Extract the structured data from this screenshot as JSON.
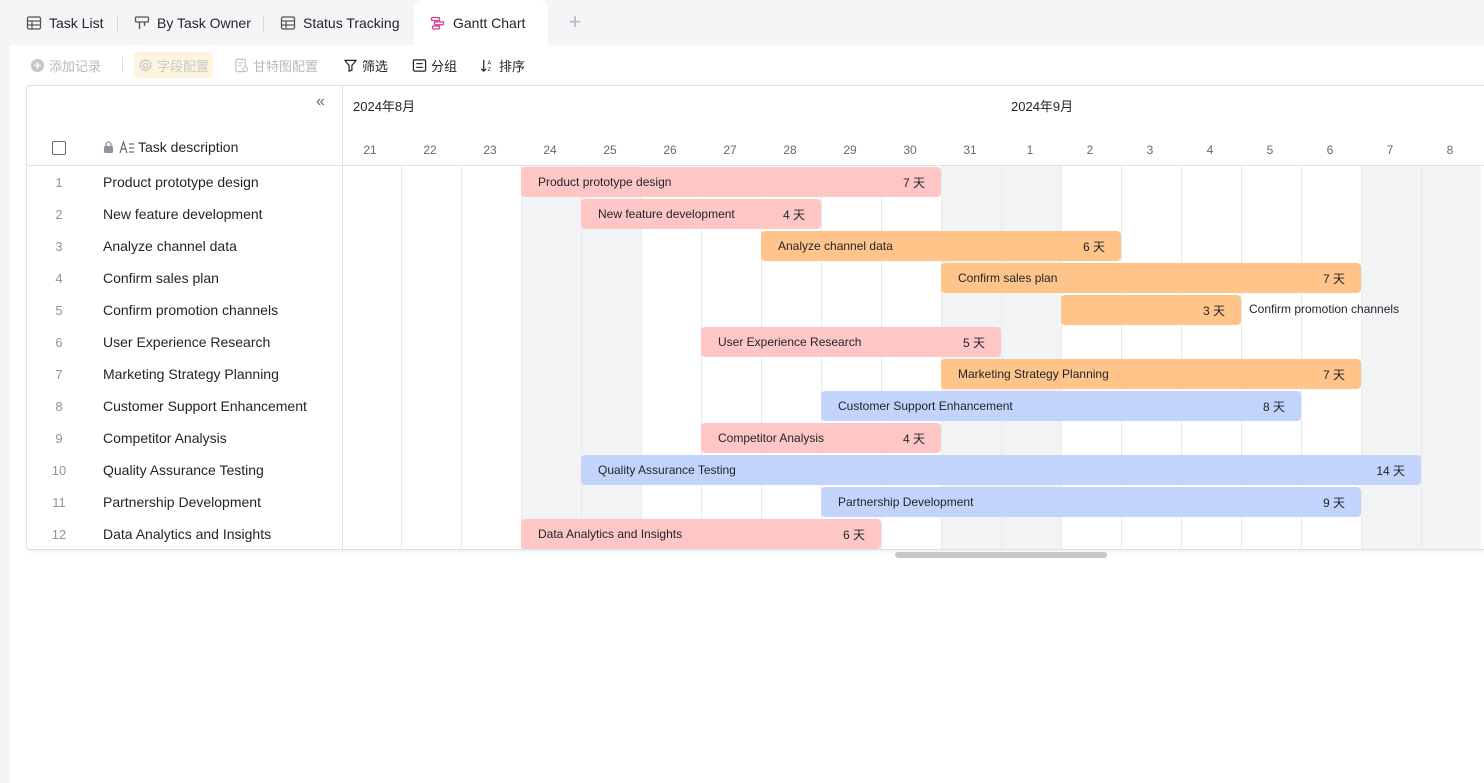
{
  "tabs": [
    {
      "label": "Task List",
      "icon": "grid-table-icon"
    },
    {
      "label": "By Task Owner",
      "icon": "kanban-icon"
    },
    {
      "label": "Status Tracking",
      "icon": "grid-table-icon"
    },
    {
      "label": "Gantt Chart",
      "icon": "gantt-icon",
      "active": true
    }
  ],
  "toolbar": {
    "add_record": "添加记录",
    "field_config": "字段配置",
    "gantt_config": "甘特图配置",
    "filter": "筛选",
    "group": "分组",
    "sort": "排序"
  },
  "grid": {
    "column_header": "Task description",
    "rows": [
      {
        "num": "1",
        "desc": "Product prototype design"
      },
      {
        "num": "2",
        "desc": "New feature development"
      },
      {
        "num": "3",
        "desc": "Analyze channel data"
      },
      {
        "num": "4",
        "desc": "Confirm sales plan"
      },
      {
        "num": "5",
        "desc": "Confirm promotion channels"
      },
      {
        "num": "6",
        "desc": "User Experience Research"
      },
      {
        "num": "7",
        "desc": "Marketing Strategy Planning"
      },
      {
        "num": "8",
        "desc": "Customer Support Enhancement"
      },
      {
        "num": "9",
        "desc": "Competitor Analysis"
      },
      {
        "num": "10",
        "desc": "Quality Assurance Testing"
      },
      {
        "num": "11",
        "desc": "Partnership Development"
      },
      {
        "num": "12",
        "desc": "Data Analytics and Insights"
      }
    ]
  },
  "timeline": {
    "months": [
      {
        "label": "2024年8月",
        "first_day_index": 0
      },
      {
        "label": "2024年9月",
        "first_day_index": 11
      }
    ],
    "days": [
      "21",
      "22",
      "23",
      "24",
      "25",
      "26",
      "27",
      "28",
      "29",
      "30",
      "31",
      "1",
      "2",
      "3",
      "4",
      "5",
      "6",
      "7",
      "8"
    ],
    "weekend_day_indexes": [
      3,
      4,
      10,
      11,
      17,
      18
    ],
    "colors": {
      "pink": "#ffc6c6",
      "orange": "#ffc48a",
      "blue": "#c2d4fc"
    },
    "bars": [
      {
        "row": 0,
        "start_day_index": 3,
        "days": 7,
        "label": "Product prototype design",
        "duration": "7 天",
        "color": "pink"
      },
      {
        "row": 1,
        "start_day_index": 4,
        "days": 4,
        "label": "New feature development",
        "duration": "4 天",
        "color": "pink"
      },
      {
        "row": 2,
        "start_day_index": 7,
        "days": 6,
        "label": "Analyze channel data",
        "duration": "6 天",
        "color": "orange"
      },
      {
        "row": 3,
        "start_day_index": 10,
        "days": 7,
        "label": "Confirm sales plan",
        "duration": "7 天",
        "color": "orange"
      },
      {
        "row": 4,
        "start_day_index": 12,
        "days": 3,
        "label": "Confirm promotion channels",
        "duration": "3 天",
        "color": "orange",
        "label_outside": true
      },
      {
        "row": 5,
        "start_day_index": 6,
        "days": 5,
        "label": "User Experience Research",
        "duration": "5 天",
        "color": "pink"
      },
      {
        "row": 6,
        "start_day_index": 10,
        "days": 7,
        "label": "Marketing Strategy Planning",
        "duration": "7 天",
        "color": "orange"
      },
      {
        "row": 7,
        "start_day_index": 8,
        "days": 8,
        "label": "Customer Support Enhancement",
        "duration": "8 天",
        "color": "blue"
      },
      {
        "row": 8,
        "start_day_index": 6,
        "days": 4,
        "label": "Competitor Analysis",
        "duration": "4 天",
        "color": "pink"
      },
      {
        "row": 9,
        "start_day_index": 4,
        "days": 14,
        "label": "Quality Assurance Testing",
        "duration": "14 天",
        "color": "blue"
      },
      {
        "row": 10,
        "start_day_index": 8,
        "days": 9,
        "label": "Partnership Development",
        "duration": "9 天",
        "color": "blue"
      },
      {
        "row": 11,
        "start_day_index": 3,
        "days": 6,
        "label": "Data Analytics and Insights",
        "duration": "6 天",
        "color": "pink"
      }
    ]
  }
}
